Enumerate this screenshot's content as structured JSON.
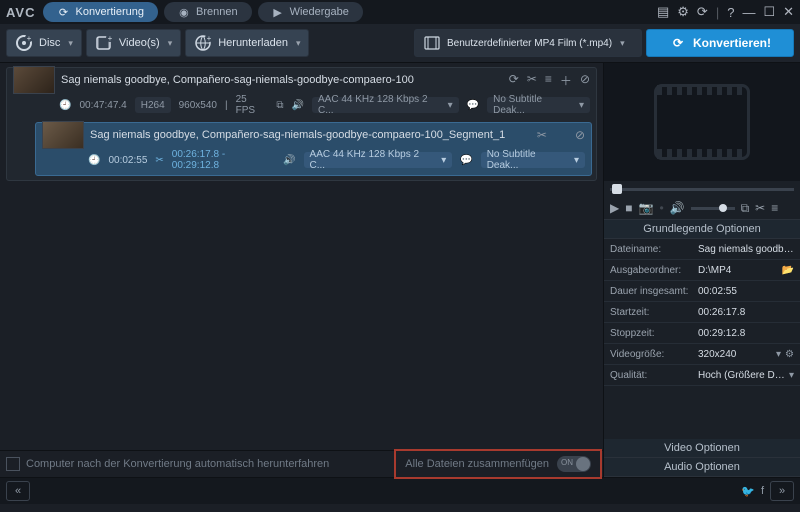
{
  "app": {
    "logo": "AVC"
  },
  "tabs": [
    {
      "label": "Konvertierung",
      "icon": "refresh-icon"
    },
    {
      "label": "Brennen",
      "icon": "disc-icon"
    },
    {
      "label": "Wiedergabe",
      "icon": "play-icon"
    }
  ],
  "toolbar": {
    "disc": "Disc",
    "videos": "Video(s)",
    "download": "Herunterladen",
    "format": "Benutzerdefinierter MP4 Film (*.mp4)",
    "convert": "Konvertieren!"
  },
  "item": {
    "title": "Sag niemals goodbye, Compañero-sag-niemals-goodbye-compaero-100",
    "duration": "00:47:47.4",
    "codec": "H264",
    "res": "960x540",
    "fps": "25 FPS",
    "audio": "AAC 44 KHz 128 Kbps 2 C...",
    "subtitle": "No Subtitle Deak..."
  },
  "segment": {
    "title": "Sag niemals goodbye, Compañero-sag-niemals-goodbye-compaero-100_Segment_1",
    "duration": "00:02:55",
    "range": "00:26:17.8 - 00:29:12.8",
    "audio": "AAC 44 KHz 128 Kbps 2 C...",
    "subtitle": "No Subtitle Deak..."
  },
  "footer": {
    "shutdown": "Computer nach der Konvertierung automatisch herunterfahren",
    "merge": "Alle Dateien zusammenfügen",
    "toggle": "ON"
  },
  "panel": {
    "basic_header": "Grundlegende Optionen",
    "rows": [
      {
        "k": "Dateiname:",
        "v": "Sag niemals goodbye, Co..."
      },
      {
        "k": "Ausgabeordner:",
        "v": "D:\\MP4"
      },
      {
        "k": "Dauer insgesamt:",
        "v": "00:02:55"
      },
      {
        "k": "Startzeit:",
        "v": "00:26:17.8"
      },
      {
        "k": "Stoppzeit:",
        "v": "00:29:12.8"
      },
      {
        "k": "Videogröße:",
        "v": "320x240"
      },
      {
        "k": "Qualität:",
        "v": "Hoch (Größere Dateigröße)"
      }
    ],
    "video_opts": "Video Optionen",
    "audio_opts": "Audio Optionen"
  }
}
